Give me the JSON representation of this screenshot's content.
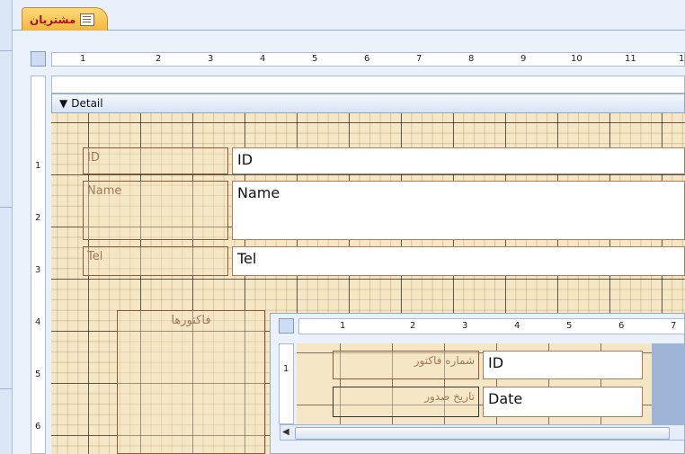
{
  "tab": {
    "title": "مشتریان"
  },
  "ruler": {
    "h_numbers": [
      "1",
      "2",
      "3",
      "4",
      "5",
      "6",
      "7",
      "8",
      "9",
      "10",
      "11",
      "1"
    ],
    "v_numbers": [
      "1",
      "2",
      "3",
      "4",
      "5",
      "6"
    ]
  },
  "section": {
    "detail_label": "Detail"
  },
  "form": {
    "id_label": "ID",
    "id_field": "ID",
    "name_label": "Name",
    "name_field": "Name",
    "tel_label": "Tel",
    "tel_field": "Tel",
    "subform_label": "فاکتورها"
  },
  "subform": {
    "h_numbers": [
      "1",
      "2",
      "3",
      "4",
      "5",
      "6",
      "7"
    ],
    "v_numbers": [
      "1"
    ],
    "invoice_no_label": "شماره فاکتور",
    "invoice_no_field": "ID",
    "date_label": "تاریخ صدور",
    "date_field": "Date"
  },
  "colors": {
    "grid_bg": "#f5e7c6",
    "tab_accent": "#f3b63e",
    "chrome_blue": "#dfe8f6"
  }
}
